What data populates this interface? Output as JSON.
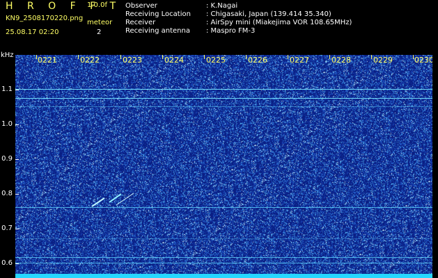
{
  "header": {
    "app_title": "H R O F F T",
    "version": "1.0.0f",
    "filename": "KN9_2508170220.png",
    "meteor_label": "meteor",
    "timestamp": "25.08.17 02:20",
    "meteor_count": "2"
  },
  "info": [
    {
      "label": "Observer",
      "value": ": K.Nagai"
    },
    {
      "label": "Receiving Location",
      "value": ": Chigasaki, Japan (139.414 35.340)"
    },
    {
      "label": "Receiver",
      "value": ": AirSpy mini (Miakejima VOR 108.65MHz)"
    },
    {
      "label": "Receiving antenna",
      "value": ": Maspro FM-3"
    }
  ],
  "axis": {
    "unit": "kHz",
    "time_labels": [
      "0221",
      "0222",
      "0223",
      "0224",
      "0225",
      "0226",
      "0227",
      "0228",
      "0229",
      "0230"
    ],
    "freq_labels": [
      "1.1",
      "1.0",
      "0.9",
      "0.8",
      "0.7",
      "0.6"
    ]
  },
  "colors": {
    "background": "#0a1f84",
    "label_yellow": "#ffff66",
    "signal_cyan": "#25d7ff",
    "signal_line": "#74e4ff"
  },
  "signals": [
    {
      "freq_khz": 1.103,
      "strength": "strong"
    },
    {
      "freq_khz": 1.077,
      "strength": "strong"
    },
    {
      "freq_khz": 1.052,
      "strength": "weak"
    },
    {
      "freq_khz": 0.762,
      "strength": "medium"
    },
    {
      "freq_khz": 0.672,
      "strength": "faint"
    },
    {
      "freq_khz": 0.619,
      "strength": "medium"
    },
    {
      "freq_khz": 0.602,
      "strength": "medium"
    }
  ]
}
